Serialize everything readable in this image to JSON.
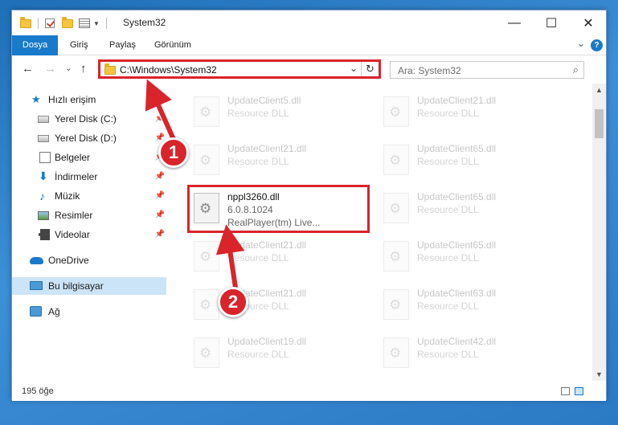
{
  "window": {
    "title": "System32",
    "controls": {
      "minimize": "—",
      "maximize": "☐",
      "close": "✕"
    }
  },
  "ribbon": {
    "tabs": [
      "Dosya",
      "Giriş",
      "Paylaş",
      "Görünüm"
    ],
    "help": "?"
  },
  "address": {
    "path": "C:\\Windows\\System32",
    "search_placeholder": "Ara: System32"
  },
  "sidebar": {
    "items": [
      {
        "label": "Hızlı erişim",
        "icon": "star-icon"
      },
      {
        "label": "Yerel Disk (C:)",
        "icon": "drive-icon"
      },
      {
        "label": "Yerel Disk (D:)",
        "icon": "drive-icon"
      },
      {
        "label": "Belgeler",
        "icon": "documents-icon"
      },
      {
        "label": "İndirmeler",
        "icon": "download-icon"
      },
      {
        "label": "Müzik",
        "icon": "music-icon"
      },
      {
        "label": "Resimler",
        "icon": "pictures-icon"
      },
      {
        "label": "Videolar",
        "icon": "videos-icon"
      },
      {
        "label": "OneDrive",
        "icon": "cloud-icon"
      },
      {
        "label": "Bu bilgisayar",
        "icon": "computer-icon"
      },
      {
        "label": "Ağ",
        "icon": "network-icon"
      }
    ]
  },
  "files": {
    "left": [
      {
        "name": "UpdateClient5.dll",
        "desc": "Resource DLL"
      },
      {
        "name": "UpdateClient21.dll",
        "desc": "Resource DLL"
      },
      {
        "name": "nppl3260.dll",
        "desc": "6.0.8.1024",
        "desc2": "RealPlayer(tm) Live..."
      },
      {
        "name": "UpdateClient21.dll",
        "desc": "Resource DLL"
      },
      {
        "name": "UpdateClient21.dll",
        "desc": "Resource DLL"
      },
      {
        "name": "UpdateClient19.dll",
        "desc": "Resource DLL"
      }
    ],
    "right": [
      {
        "name": "UpdateClient21.dll",
        "desc": "Resource DLL"
      },
      {
        "name": "UpdateClient65.dll",
        "desc": "Resource DLL"
      },
      {
        "name": "UpdateClient65.dll",
        "desc": "Resource DLL"
      },
      {
        "name": "UpdateClient65.dll",
        "desc": "Resource DLL"
      },
      {
        "name": "UpdateClient63.dll",
        "desc": "Resource DLL"
      },
      {
        "name": "UpdateClient42.dll",
        "desc": "Resource DLL"
      }
    ]
  },
  "status": {
    "count": "195 öğe"
  },
  "annotations": {
    "badge1": "1",
    "badge2": "2"
  }
}
